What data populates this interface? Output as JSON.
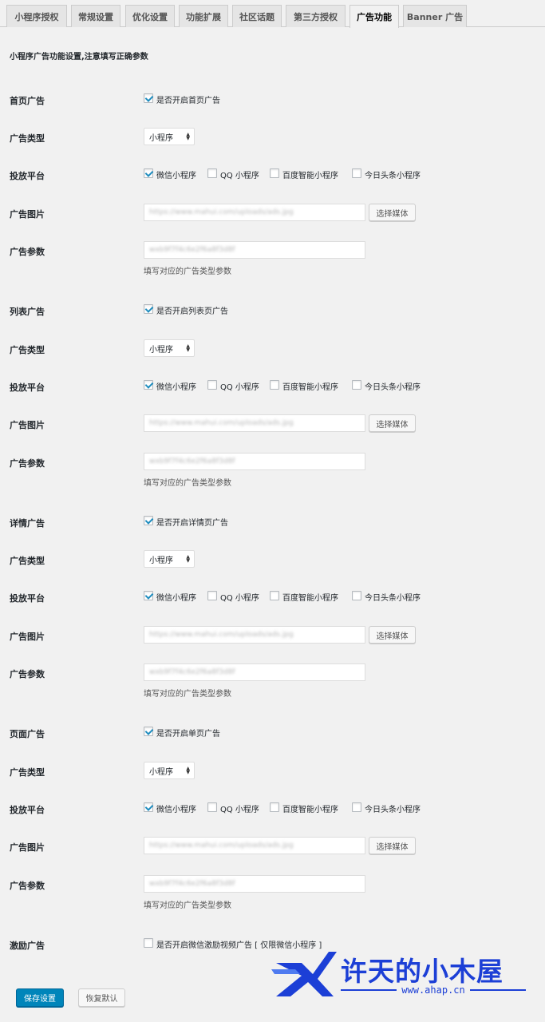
{
  "tabs": [
    "小程序授权",
    "常规设置",
    "优化设置",
    "功能扩展",
    "社区话题",
    "第三方授权",
    "广告功能",
    "Banner 广告"
  ],
  "intro": "小程序广告功能设置,注意填写正确参数",
  "sections": [
    {
      "label": "首页广告",
      "enable_label": "是否开启首页广告",
      "enabled": true,
      "type_label": "广告类型",
      "type_value": "小程序",
      "platform_label": "投放平台",
      "platforms": [
        {
          "label": "微信小程序",
          "checked": true
        },
        {
          "label": "QQ 小程序",
          "checked": false
        },
        {
          "label": "百度智能小程序",
          "checked": false
        },
        {
          "label": "今日头条小程序",
          "checked": false
        }
      ],
      "image_label": "广告图片",
      "image_value": "https://www.mahui.com/uploads/ads.jpg",
      "media_button": "选择媒体",
      "param_label": "广告参数",
      "param_value": "wxb9f7f4c6e2f6a8f3d8f",
      "param_desc": "填写对应的广告类型参数"
    },
    {
      "label": "列表广告",
      "enable_label": "是否开启列表页广告",
      "enabled": true,
      "type_label": "广告类型",
      "type_value": "小程序",
      "platform_label": "投放平台",
      "platforms": [
        {
          "label": "微信小程序",
          "checked": true
        },
        {
          "label": "QQ 小程序",
          "checked": false
        },
        {
          "label": "百度智能小程序",
          "checked": false
        },
        {
          "label": "今日头条小程序",
          "checked": false
        }
      ],
      "image_label": "广告图片",
      "image_value": "https://www.mahui.com/uploads/ads.jpg",
      "media_button": "选择媒体",
      "param_label": "广告参数",
      "param_value": "wxb9f7f4c6e2f6a8f3d8f",
      "param_desc": "填写对应的广告类型参数"
    },
    {
      "label": "详情广告",
      "enable_label": "是否开启详情页广告",
      "enabled": true,
      "type_label": "广告类型",
      "type_value": "小程序",
      "platform_label": "投放平台",
      "platforms": [
        {
          "label": "微信小程序",
          "checked": true
        },
        {
          "label": "QQ 小程序",
          "checked": false
        },
        {
          "label": "百度智能小程序",
          "checked": false
        },
        {
          "label": "今日头条小程序",
          "checked": false
        }
      ],
      "image_label": "广告图片",
      "image_value": "https://www.mahui.com/uploads/ads.jpg",
      "media_button": "选择媒体",
      "param_label": "广告参数",
      "param_value": "wxb9f7f4c6e2f6a8f3d8f",
      "param_desc": "填写对应的广告类型参数"
    },
    {
      "label": "页面广告",
      "enable_label": "是否开启单页广告",
      "enabled": true,
      "type_label": "广告类型",
      "type_value": "小程序",
      "platform_label": "投放平台",
      "platforms": [
        {
          "label": "微信小程序",
          "checked": true
        },
        {
          "label": "QQ 小程序",
          "checked": false
        },
        {
          "label": "百度智能小程序",
          "checked": false
        },
        {
          "label": "今日头条小程序",
          "checked": false
        }
      ],
      "image_label": "广告图片",
      "image_value": "https://www.mahui.com/uploads/ads.jpg",
      "media_button": "选择媒体",
      "param_label": "广告参数",
      "param_value": "wxb9f7f4c6e2f6a8f3d8f",
      "param_desc": "填写对应的广告类型参数"
    }
  ],
  "reward": {
    "label": "激励广告",
    "enable_label": "是否开启微信激励视频广告 [ 仅限微信小程序 ]",
    "enabled": false
  },
  "buttons": {
    "save": "保存设置",
    "reset": "恢复默认"
  },
  "watermark": {
    "title": "许天的小木屋",
    "url": "www.ahap.cn"
  },
  "colors": {
    "primary": "#0085ba",
    "checkmark": "#1e8cbe",
    "watermark": "#1c3fd6"
  }
}
